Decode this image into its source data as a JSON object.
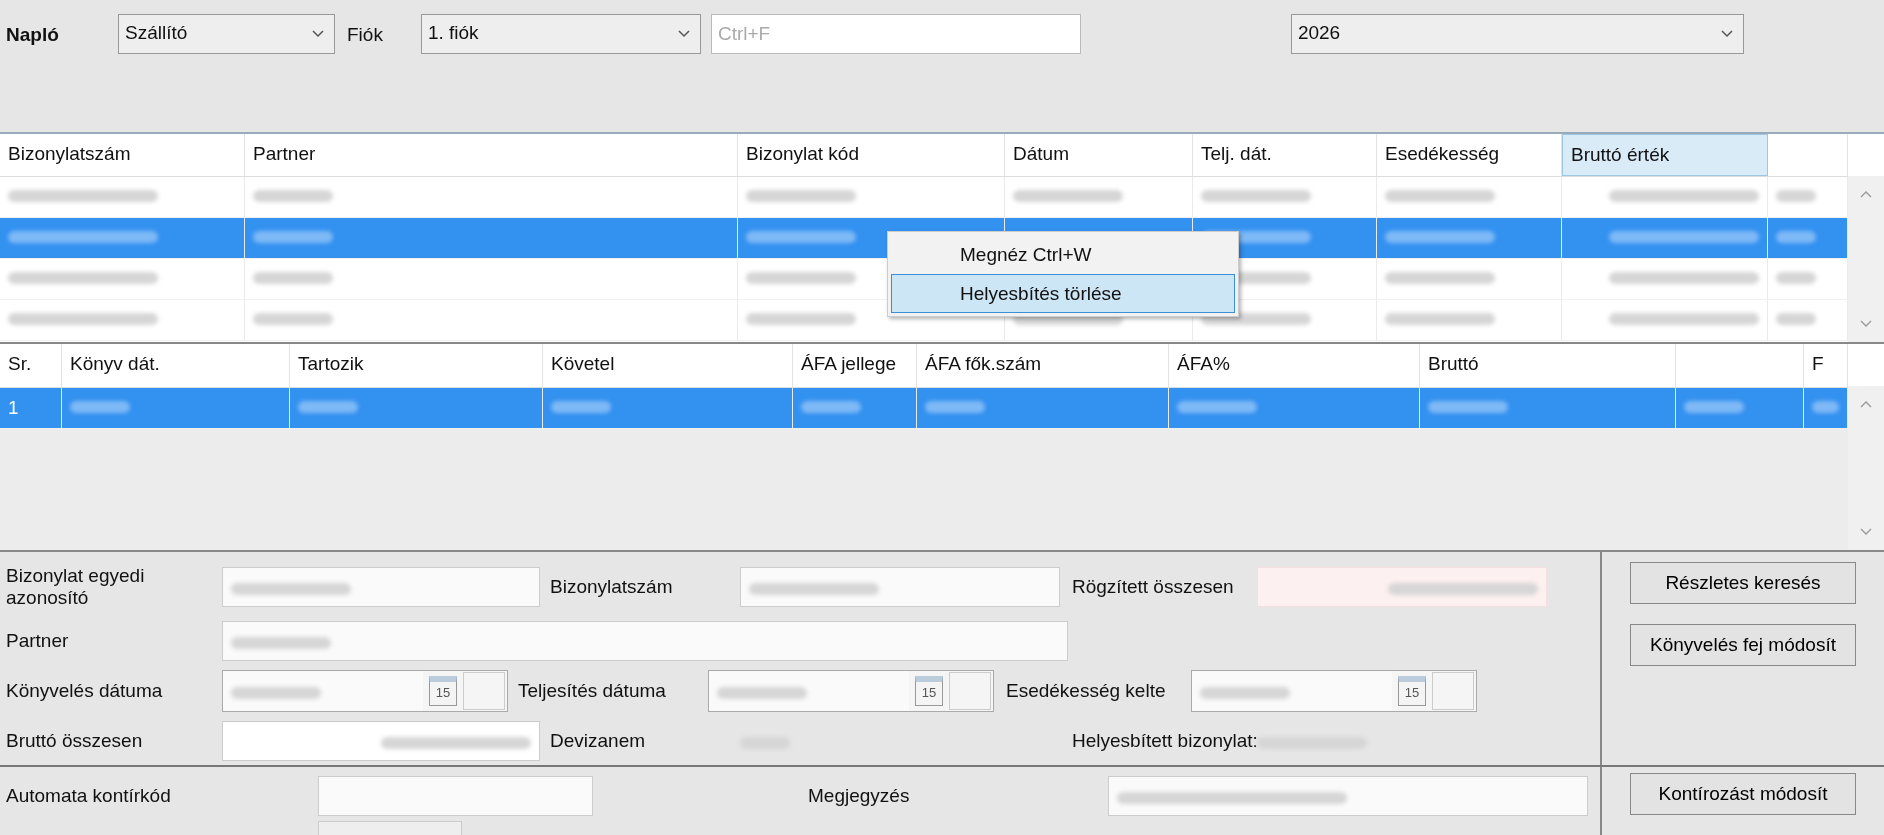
{
  "toolbar": {
    "journal_label": "Napló",
    "journal": "Szállító",
    "branch_label": "Fiók",
    "branch": "1. fiók",
    "search": {
      "placeholder": "Ctrl+F"
    },
    "year": "2026"
  },
  "documents": {
    "columns": [
      {
        "label": "Bizonylatszám",
        "selected": false
      },
      {
        "label": "Partner",
        "selected": false
      },
      {
        "label": "Bizonylat kód",
        "selected": false
      },
      {
        "label": "Dátum",
        "selected": false
      },
      {
        "label": "Telj. dát.",
        "selected": false
      },
      {
        "label": "Esedékesség",
        "selected": false
      },
      {
        "label": "Bruttó érték",
        "selected": true
      }
    ],
    "rows": [
      {
        "selected": false
      },
      {
        "selected": true
      },
      {
        "selected": false
      },
      {
        "selected": false
      }
    ]
  },
  "context_menu": {
    "items": [
      {
        "label": "Megnéz Ctrl+W",
        "selected": false
      },
      {
        "label": "Helyesbítés törlése",
        "selected": true
      }
    ]
  },
  "entries": {
    "columns": [
      "Sr.",
      "Könyv dát.",
      "Tartozik",
      "Követel",
      "ÁFA jellege",
      "ÁFA fők.szám",
      "ÁFA%",
      "Bruttó",
      "",
      "F"
    ],
    "rows": [
      {
        "sr": "1",
        "selected": true
      }
    ]
  },
  "form": {
    "unique_id": {
      "label": "Bizonylat egyedi azonosító",
      "redacted": true
    },
    "doc_number": {
      "label": "Bizonylatszám",
      "redacted": true
    },
    "recorded_total": {
      "label": "Rögzített összesen",
      "redacted": true
    },
    "partner": {
      "label": "Partner",
      "redacted": true
    },
    "posting_date": {
      "label": "Könyvelés dátuma",
      "redacted": true,
      "calendar_day": "15"
    },
    "fulfilment_date": {
      "label": "Teljesítés dátuma",
      "redacted": true,
      "calendar_day": "15"
    },
    "due_date": {
      "label": "Esedékesség kelte",
      "redacted": true,
      "calendar_day": "15"
    },
    "gross_total": {
      "label": "Bruttó összesen",
      "redacted": true
    },
    "currency": {
      "label": "Devizanem",
      "redacted": true
    },
    "corrected_doc": {
      "label": "Helyesbített bizonylat:",
      "redacted": true
    }
  },
  "buttons": [
    "Részletes keresés",
    "Könyvelés fej módosít"
  ],
  "bottom": {
    "auto_code_label": "Automata kontírkód",
    "note": {
      "label": "Megjegyzés",
      "redacted": true
    },
    "button": "Kontírozást módosít"
  }
}
